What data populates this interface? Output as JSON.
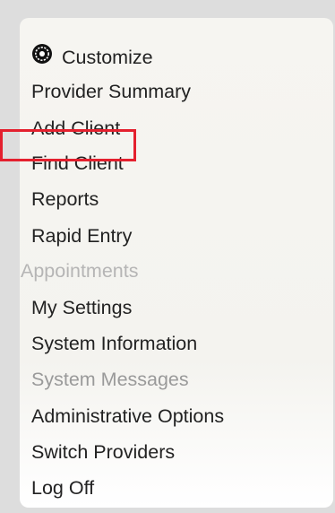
{
  "menu": {
    "items": [
      {
        "label": "Customize",
        "icon": "gear-icon"
      },
      {
        "label": "Provider Summary"
      },
      {
        "label": "Add Client"
      },
      {
        "label": "Find Client",
        "highlighted": true,
        "highlight_color": "#e4202e"
      },
      {
        "label": "Reports"
      },
      {
        "label": "Rapid Entry"
      },
      {
        "label": "Appointments",
        "disabled": true
      },
      {
        "label": "My Settings"
      },
      {
        "label": "System Information"
      },
      {
        "label": "System Messages",
        "disabled": true
      },
      {
        "label": "Administrative Options"
      },
      {
        "label": "Switch Providers"
      },
      {
        "label": "Log Off"
      }
    ]
  }
}
